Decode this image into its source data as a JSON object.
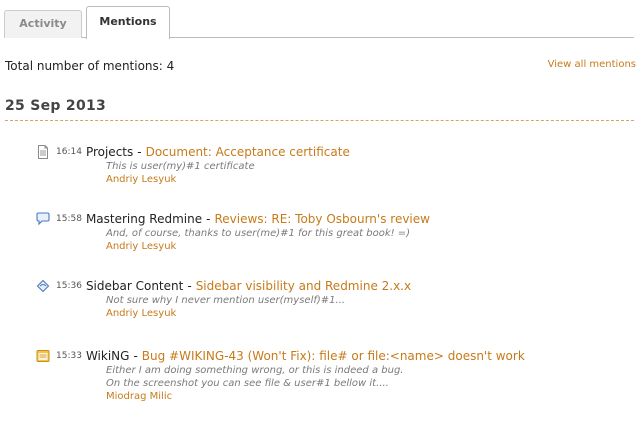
{
  "tabs": [
    {
      "label": "Activity",
      "active": false
    },
    {
      "label": "Mentions",
      "active": true
    }
  ],
  "summary": {
    "total_text": "Total number of mentions: 4",
    "view_all_label": "View all mentions"
  },
  "date_heading": "25 Sep 2013",
  "mentions": [
    {
      "icon": "document-icon",
      "time": "16:14",
      "project": "Projects",
      "title": "Document: Acceptance certificate",
      "body": [
        "This is user(my)#1 certificate"
      ],
      "author": "Andriy Lesyuk"
    },
    {
      "icon": "comment-icon",
      "time": "15:58",
      "project": "Mastering Redmine",
      "title": "Reviews: RE: Toby Osbourn's review",
      "body": [
        "And, of course, thanks to user(me)#1 for this great book! =)"
      ],
      "author": "Andriy Lesyuk"
    },
    {
      "icon": "forum-reply-icon",
      "time": "15:36",
      "project": "Sidebar Content",
      "title": "Sidebar visibility and Redmine 2.x.x",
      "body": [
        "Not sure why I never mention user(myself)#1..."
      ],
      "author": "Andriy Lesyuk"
    },
    {
      "icon": "issue-icon",
      "time": "15:33",
      "project": "WikiNG",
      "title": "Bug #WIKING-43 (Won't Fix): file# or file:<name> doesn't work",
      "body": [
        "Either I am doing something wrong, or this is indeed a bug.",
        "On the screenshot you can see file & user#1 bellow it...."
      ],
      "author": "Miodrag Milic"
    }
  ],
  "colors": {
    "link": "#c77a1a",
    "rule": "#e0a060"
  }
}
